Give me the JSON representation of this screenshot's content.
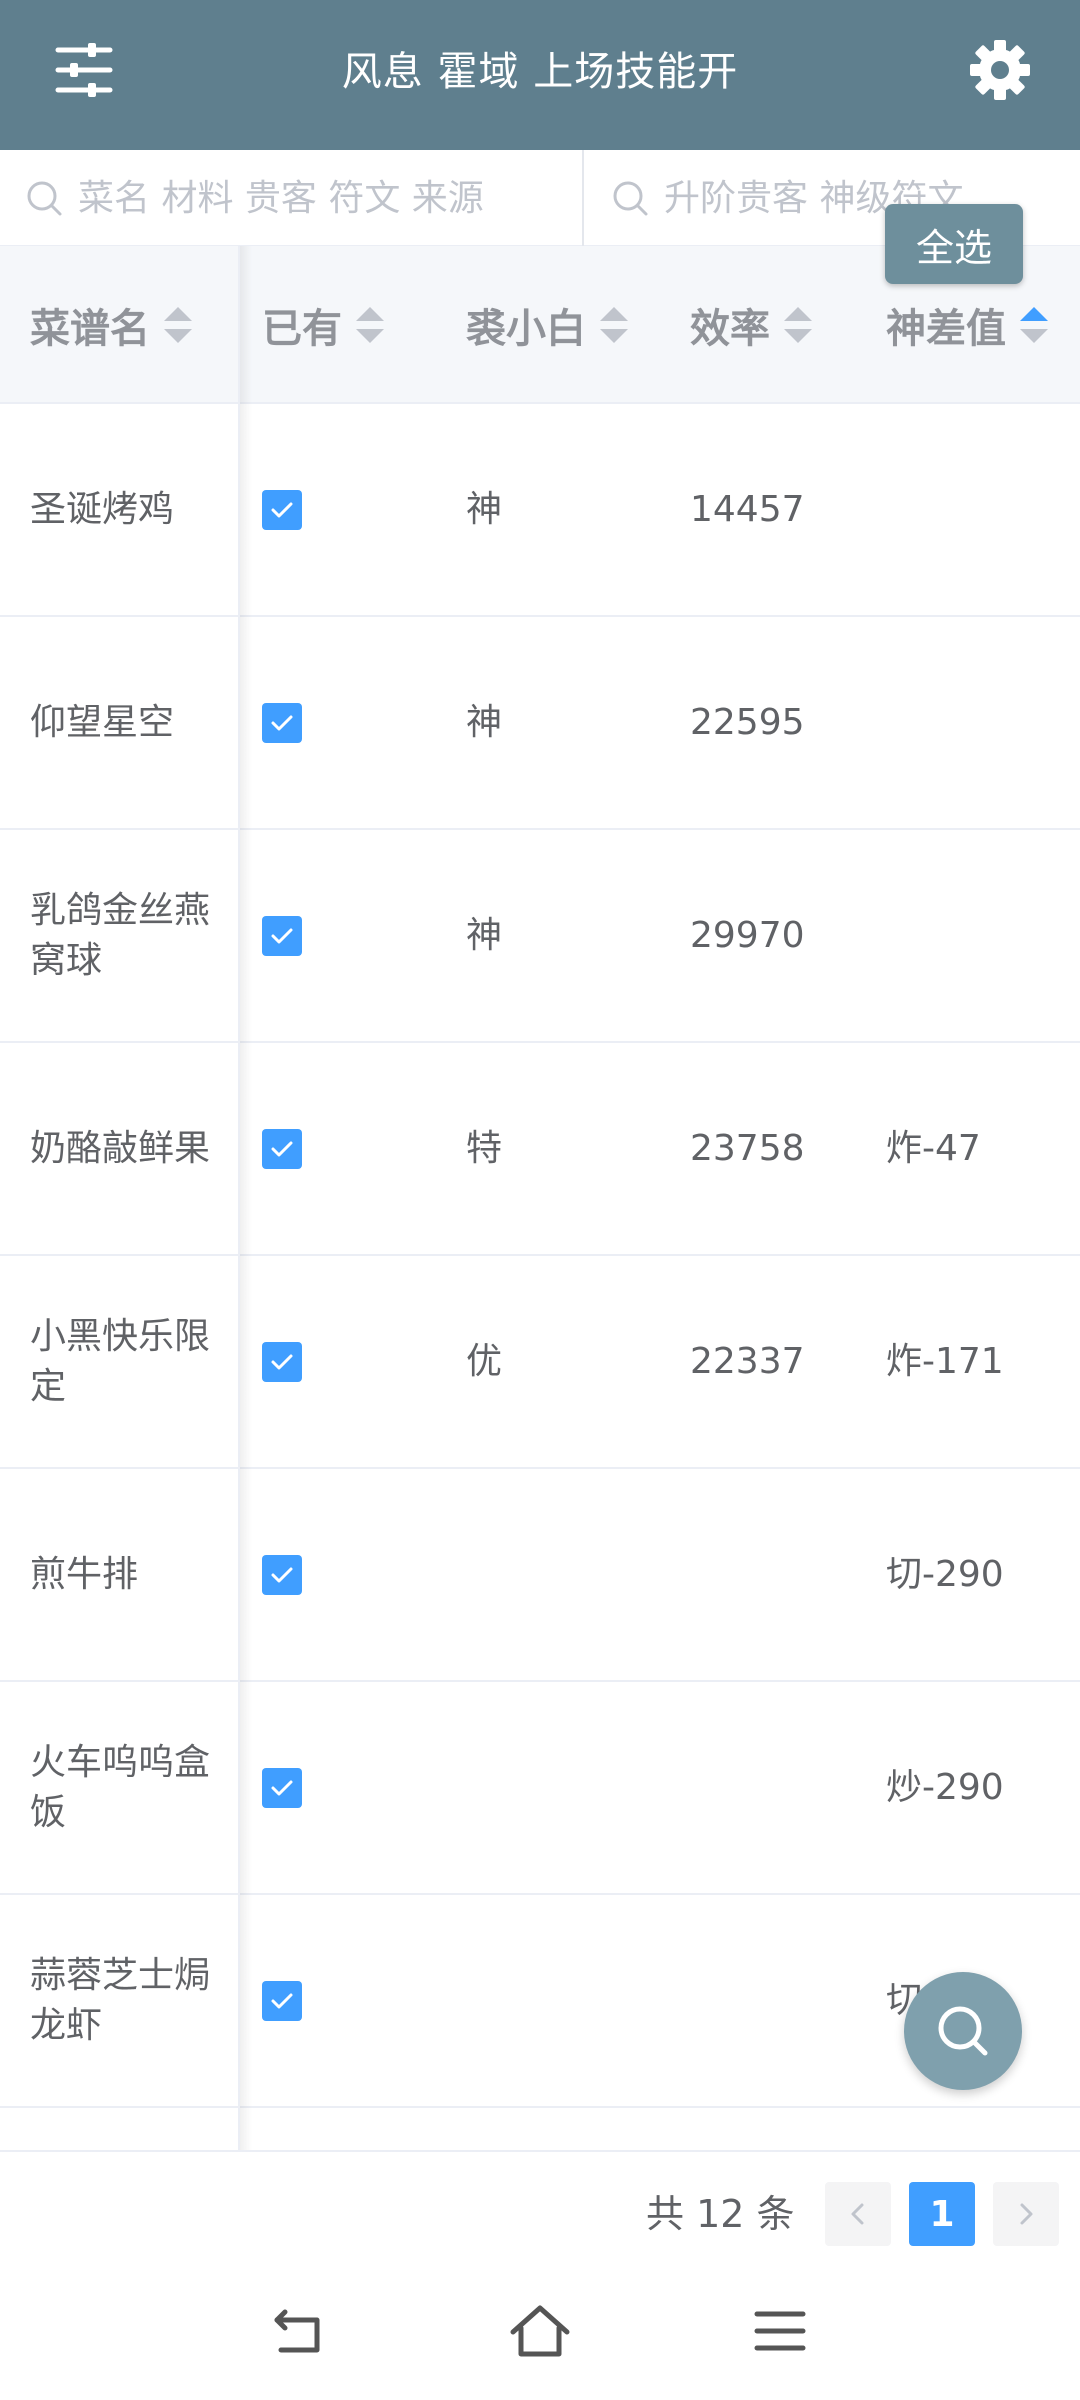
{
  "header": {
    "title": "风息 霍域 上场技能开",
    "filter_icon": "sliders-icon",
    "settings_icon": "gear-icon"
  },
  "search": {
    "left_placeholder": "菜名 材料 贵客 符文 来源",
    "right_placeholder": "升阶贵客 神级符文",
    "select_all_label": "全选"
  },
  "table": {
    "columns": [
      {
        "key": "name",
        "label": "菜谱名"
      },
      {
        "key": "owned",
        "label": "已有"
      },
      {
        "key": "grade",
        "label": "裘小白"
      },
      {
        "key": "efficiency",
        "label": "效率"
      },
      {
        "key": "god_diff",
        "label": "神差值"
      }
    ],
    "rows": [
      {
        "name": "圣诞烤鸡",
        "owned": true,
        "grade": "神",
        "efficiency": "14457",
        "god_diff": ""
      },
      {
        "name": "仰望星空",
        "owned": true,
        "grade": "神",
        "efficiency": "22595",
        "god_diff": ""
      },
      {
        "name": "乳鸽金丝燕窝球",
        "owned": true,
        "grade": "神",
        "efficiency": "29970",
        "god_diff": ""
      },
      {
        "name": "奶酪敲鲜果",
        "owned": true,
        "grade": "特",
        "efficiency": "23758",
        "god_diff": "炸-47"
      },
      {
        "name": "小黑快乐限定",
        "owned": true,
        "grade": "优",
        "efficiency": "22337",
        "god_diff": "炸-171"
      },
      {
        "name": "煎牛排",
        "owned": true,
        "grade": "",
        "efficiency": "",
        "god_diff": "切-290"
      },
      {
        "name": "火车呜呜盒饭",
        "owned": true,
        "grade": "",
        "efficiency": "",
        "god_diff": "炒-290"
      },
      {
        "name": "蒜蓉芝士焗龙虾",
        "owned": true,
        "grade": "",
        "efficiency": "",
        "god_diff": "切"
      }
    ]
  },
  "pagination": {
    "total_label": "共 12 条",
    "current_page": "1"
  },
  "colors": {
    "header_bg": "#5f7f8e",
    "accent": "#409eff",
    "select_all_bg": "#6e8f9c",
    "fab_bg": "#7fa0ad"
  }
}
